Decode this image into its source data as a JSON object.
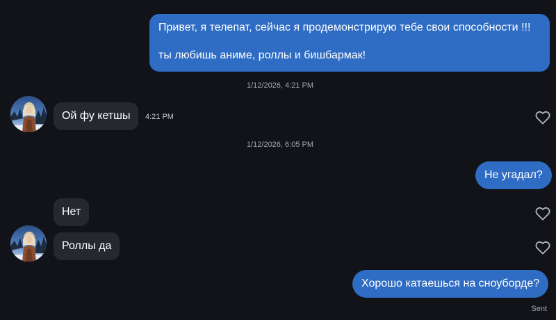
{
  "messages": {
    "msg1": {
      "line1": "Привет, я телепат, сейчас я продемонстрирую тебе свои способности !!!",
      "line2": "ты любишь аниме, роллы и бишбармак!"
    },
    "timestamp1": "1/12/2026, 4:21 PM",
    "msg2": {
      "text": "Ой фу кетшы",
      "time": "4:21 PM"
    },
    "timestamp2": "1/12/2026, 6:05 PM",
    "msg3": {
      "text": "Не угадал?"
    },
    "msg4": {
      "text": "Нет"
    },
    "msg5": {
      "text": "Роллы да"
    },
    "msg6": {
      "text": "Хорошо катаешься на сноуборде?"
    },
    "status": "Sent"
  },
  "icons": {
    "like": "heart-outline-icon",
    "avatar": "user-avatar"
  },
  "colors": {
    "background": "#111318",
    "outgoing_bubble": "#2f6cc3",
    "incoming_bubble": "#262830",
    "meta_text": "#a5a8b2"
  }
}
